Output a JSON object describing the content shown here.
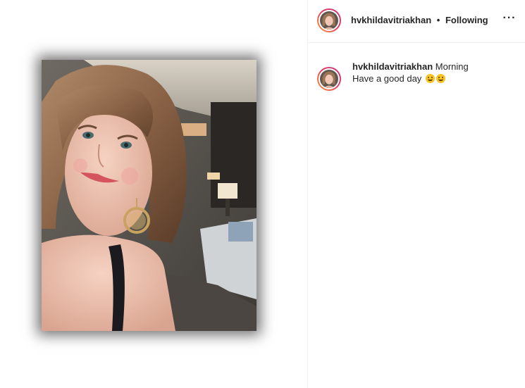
{
  "post": {
    "username": "hvkhildavitriakhan",
    "separator": "•",
    "follow_status": "Following",
    "more_icon": "more-options-icon",
    "photo_alt": "selfie-photo"
  },
  "comment": {
    "username": "hvkhildavitriakhan",
    "caption_line1": "Morning",
    "caption_line2": "Have a good day",
    "emojis": [
      "yum-face-emoji",
      "yum-face-emoji"
    ]
  },
  "colors": {
    "avatar_ring_start": "#f9a03f",
    "avatar_ring_end": "#c13584",
    "text": "#262626",
    "divider": "#efefef"
  }
}
